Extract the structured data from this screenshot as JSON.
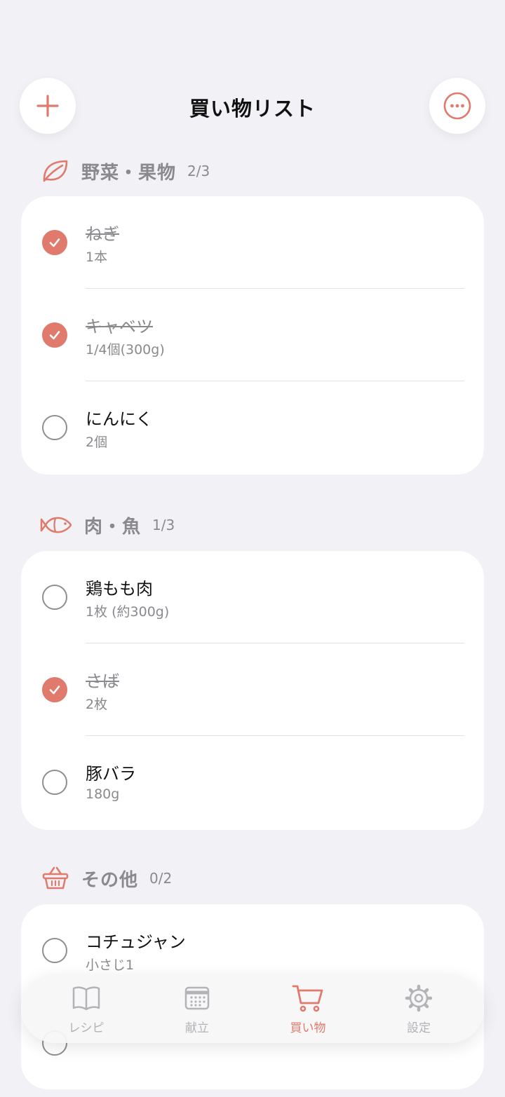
{
  "header": {
    "title": "買い物リスト",
    "add_icon": "plus-icon",
    "more_icon": "ellipsis-circle-icon"
  },
  "sections": [
    {
      "icon": "leaf-icon",
      "title": "野菜・果物",
      "count": "2/3",
      "items": [
        {
          "name": "ねぎ",
          "qty": "1本",
          "checked": true
        },
        {
          "name": "キャベツ",
          "qty": "1/4個(300g)",
          "checked": true
        },
        {
          "name": "にんにく",
          "qty": "2個",
          "checked": false
        }
      ]
    },
    {
      "icon": "fish-icon",
      "title": "肉・魚",
      "count": "1/3",
      "items": [
        {
          "name": "鶏もも肉",
          "qty": "1枚 (約300g)",
          "checked": false
        },
        {
          "name": "さば",
          "qty": "2枚",
          "checked": true
        },
        {
          "name": "豚バラ",
          "qty": "180g",
          "checked": false
        }
      ]
    },
    {
      "icon": "basket-icon",
      "title": "その他",
      "count": "0/2",
      "items": [
        {
          "name": "コチュジャン",
          "qty": "小さじ1",
          "checked": false
        }
      ]
    }
  ],
  "tabbar": {
    "tabs": [
      {
        "label": "レシピ",
        "icon": "book-icon",
        "active": false
      },
      {
        "label": "献立",
        "icon": "calendar-icon",
        "active": false
      },
      {
        "label": "買い物",
        "icon": "cart-icon",
        "active": true
      },
      {
        "label": "設定",
        "icon": "gear-icon",
        "active": false
      }
    ]
  },
  "colors": {
    "accent": "#df7a6c",
    "background": "#f1f1f6",
    "muted": "#8a8a8e"
  }
}
